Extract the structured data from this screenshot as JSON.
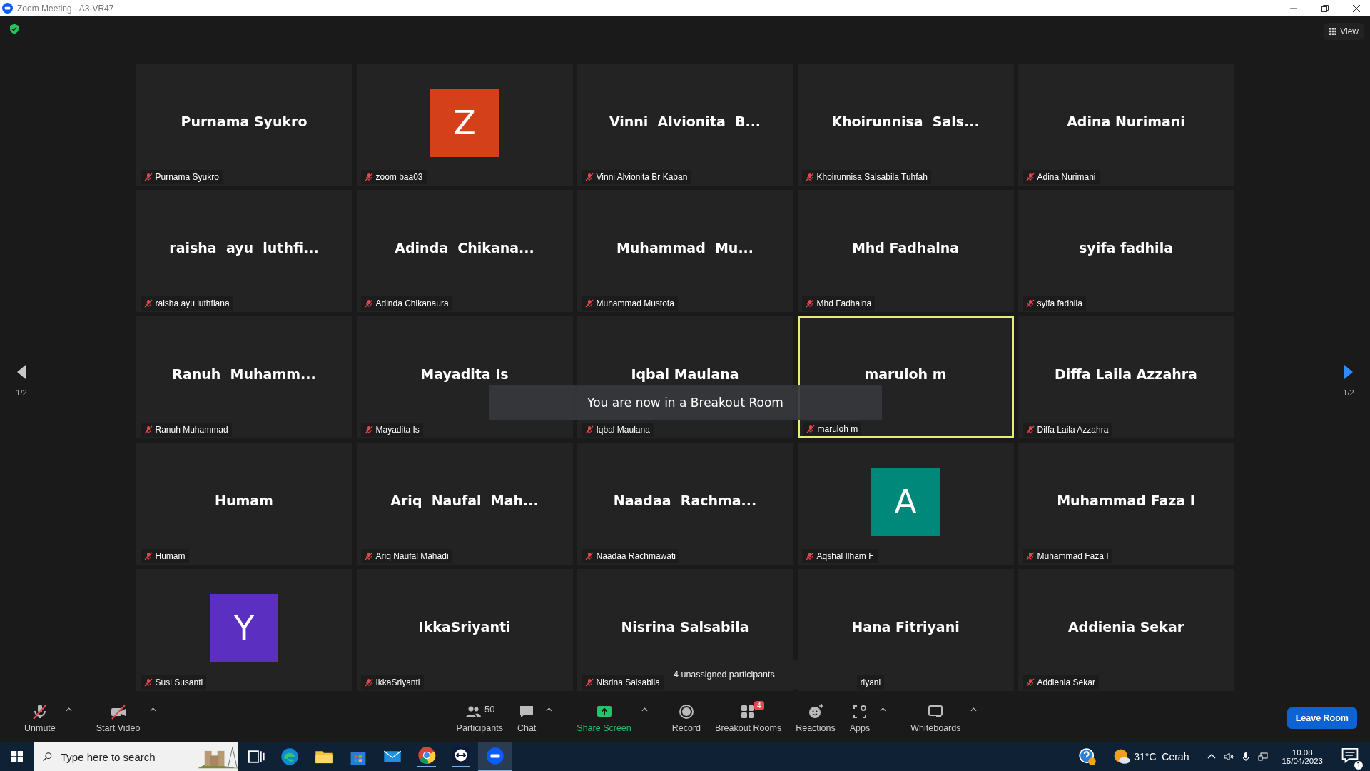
{
  "window": {
    "title": "Zoom Meeting - A3-VR47"
  },
  "view_button": "View",
  "pager": {
    "left": "1/2",
    "right": "1/2"
  },
  "tiles": [
    {
      "kind": "name",
      "title": "Purnama Syukro",
      "label": "Purnama Syukro",
      "highlighted": false
    },
    {
      "kind": "avatar",
      "title": "Z",
      "color": "#d4401a",
      "label": "zoom baa03",
      "highlighted": false
    },
    {
      "kind": "name",
      "title": "Vinni  Alvionita  B...",
      "label": "Vinni Alvionita Br Kaban",
      "highlighted": false
    },
    {
      "kind": "name",
      "title": "Khoirunnisa  Sals...",
      "label": "Khoirunnisa Salsabila Tuhfah",
      "highlighted": false
    },
    {
      "kind": "name",
      "title": "Adina Nurimani",
      "label": "Adina Nurimani",
      "highlighted": false
    },
    {
      "kind": "name",
      "title": "raisha  ayu  luthfi...",
      "label": "raisha ayu luthfiana",
      "highlighted": false
    },
    {
      "kind": "name",
      "title": "Adinda  Chikana...",
      "label": "Adinda Chikanaura",
      "highlighted": false
    },
    {
      "kind": "name",
      "title": "Muhammad  Mu...",
      "label": "Muhammad Mustofa",
      "highlighted": false
    },
    {
      "kind": "name",
      "title": "Mhd Fadhalna",
      "label": "Mhd Fadhalna",
      "highlighted": false
    },
    {
      "kind": "name",
      "title": "syifa fadhila",
      "label": "syifa fadhila",
      "highlighted": false
    },
    {
      "kind": "name",
      "title": "Ranuh  Muhamm...",
      "label": "Ranuh Muhammad",
      "highlighted": false
    },
    {
      "kind": "name",
      "title": "Mayadita Is",
      "label": "Mayadita Is",
      "highlighted": false
    },
    {
      "kind": "name",
      "title": "Iqbal Maulana",
      "label": "Iqbal Maulana",
      "highlighted": false
    },
    {
      "kind": "name",
      "title": "maruloh m",
      "label": "maruloh m",
      "highlighted": true
    },
    {
      "kind": "name",
      "title": "Diffa Laila Azzahra",
      "label": "Diffa Laila Azzahra",
      "highlighted": false
    },
    {
      "kind": "name",
      "title": "Humam",
      "label": "Humam",
      "highlighted": false
    },
    {
      "kind": "name",
      "title": "Ariq  Naufal  Mah...",
      "label": "Ariq Naufal Mahadi",
      "highlighted": false
    },
    {
      "kind": "name",
      "title": "Naadaa  Rachma...",
      "label": "Naadaa Rachmawati",
      "highlighted": false
    },
    {
      "kind": "avatar",
      "title": "A",
      "color": "#00897b",
      "label": "Aqshal Ilham F",
      "highlighted": false
    },
    {
      "kind": "name",
      "title": "Muhammad Faza I",
      "label": "Muhammad Faza I",
      "highlighted": false
    },
    {
      "kind": "avatar",
      "title": "Y",
      "color": "#5b2fc0",
      "label": "Susi Susanti",
      "highlighted": false
    },
    {
      "kind": "name",
      "title": "IkkaSriyanti",
      "label": "IkkaSriyanti",
      "highlighted": false
    },
    {
      "kind": "name",
      "title": "Nisrina Salsabila",
      "label": "Nisrina Salsabila",
      "highlighted": false
    },
    {
      "kind": "name",
      "title": "Hana Fitriyani",
      "label": "riyani",
      "highlighted": false,
      "label_covered": true
    },
    {
      "kind": "name",
      "title": "Addienia Sekar",
      "label": "Addienia Sekar",
      "highlighted": false
    }
  ],
  "toast": "You are now in a Breakout Room",
  "unassigned_tooltip": "4 unassigned participants",
  "toolbar": [
    {
      "kind": "mic",
      "label": "Unmute",
      "caret": true
    },
    {
      "kind": "video",
      "label": "Start Video",
      "caret": true
    },
    {
      "kind": "spacer"
    },
    {
      "kind": "participants",
      "label": "Participants",
      "count": "50",
      "caret": false
    },
    {
      "kind": "chat",
      "label": "Chat",
      "caret": true
    },
    {
      "kind": "share",
      "label": "Share Screen",
      "caret": true
    },
    {
      "kind": "record",
      "label": "Record",
      "caret": false
    },
    {
      "kind": "breakout",
      "label": "Breakout Rooms",
      "badge": "4",
      "caret": false
    },
    {
      "kind": "reactions",
      "label": "Reactions",
      "caret": false
    },
    {
      "kind": "apps",
      "label": "Apps",
      "caret": true
    },
    {
      "kind": "whiteboards",
      "label": "Whiteboards",
      "caret": true
    },
    {
      "kind": "spacer"
    }
  ],
  "leave_button": "Leave Room",
  "taskbar": {
    "search_placeholder": "Type here to search",
    "weather": "31°C  Cerah",
    "time": "10.08",
    "date": "15/04/2023",
    "notifications": "1"
  }
}
